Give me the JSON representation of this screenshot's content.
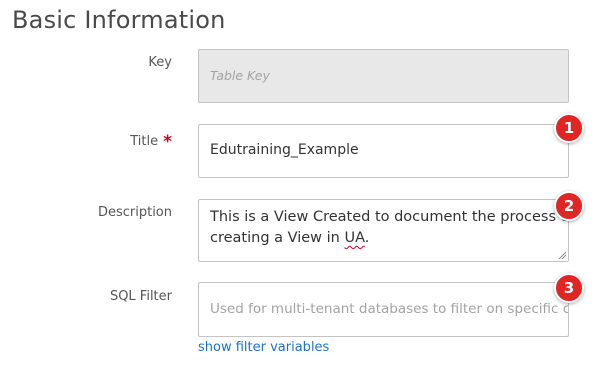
{
  "section": {
    "title": "Basic Information"
  },
  "fields": {
    "key": {
      "label": "Key",
      "placeholder": "Table Key"
    },
    "title": {
      "label": "Title",
      "required_mark": "*",
      "value": "Edutraining_Example"
    },
    "description": {
      "label": "Description",
      "value_line1": "This is a View Created to document the process of",
      "value_line2_before": "creating a View in ",
      "value_line2_misspelled": "UA",
      "value_line2_after": "."
    },
    "sql_filter": {
      "label": "SQL Filter",
      "placeholder": "Used for multi-tenant databases to filter on specific cli"
    }
  },
  "links": {
    "show_filter_variables": "show filter variables"
  },
  "badges": [
    "1",
    "2",
    "3"
  ],
  "colors": {
    "badge": "#e12525",
    "required": "#d0021b",
    "link": "#1a73c9",
    "disabled_bg": "#e8e8e8"
  }
}
